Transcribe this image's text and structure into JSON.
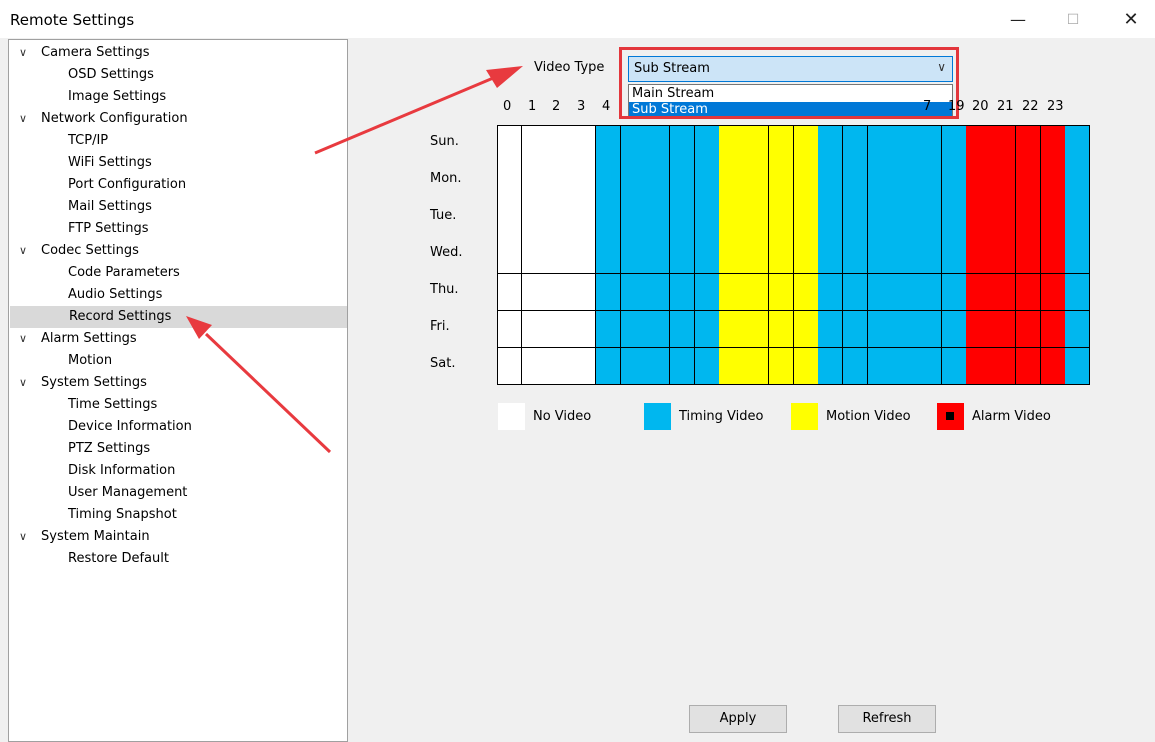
{
  "window": {
    "title": "Remote Settings",
    "controls": {
      "minimize": "—",
      "maximize": "☐",
      "close": "✕"
    }
  },
  "tree": {
    "selected": "Record Settings",
    "nodes": [
      {
        "label": "Camera Settings",
        "level": 0
      },
      {
        "label": "OSD Settings",
        "level": 1
      },
      {
        "label": "Image Settings",
        "level": 1
      },
      {
        "label": "Network Configuration",
        "level": 0
      },
      {
        "label": "TCP/IP",
        "level": 1
      },
      {
        "label": "WiFi Settings",
        "level": 1
      },
      {
        "label": "Port Configuration",
        "level": 1
      },
      {
        "label": "Mail Settings",
        "level": 1
      },
      {
        "label": "FTP Settings",
        "level": 1
      },
      {
        "label": "Codec Settings",
        "level": 0
      },
      {
        "label": "Code Parameters",
        "level": 1
      },
      {
        "label": "Audio Settings",
        "level": 1
      },
      {
        "label": "Record Settings",
        "level": 1
      },
      {
        "label": "Alarm Settings",
        "level": 0
      },
      {
        "label": "Motion",
        "level": 1
      },
      {
        "label": "System Settings",
        "level": 0
      },
      {
        "label": "Time Settings",
        "level": 1
      },
      {
        "label": "Device Information",
        "level": 1
      },
      {
        "label": "PTZ Settings",
        "level": 1
      },
      {
        "label": "Disk Information",
        "level": 1
      },
      {
        "label": "User Management",
        "level": 1
      },
      {
        "label": "Timing Snapshot",
        "level": 1
      },
      {
        "label": "System Maintain",
        "level": 0
      },
      {
        "label": "Restore Default",
        "level": 1
      }
    ]
  },
  "video_type": {
    "label": "Video Type",
    "selected": "Sub Stream",
    "options": [
      "Main Stream",
      "Sub Stream"
    ],
    "highlighted": "Sub Stream"
  },
  "schedule": {
    "hours": [
      "0",
      "1",
      "2",
      "3",
      "4",
      "",
      "",
      "",
      "",
      "",
      "",
      "",
      "",
      "",
      "",
      "",
      "",
      "7",
      "19",
      "20",
      "21",
      "22",
      "23"
    ],
    "days": [
      "Sun.",
      "Mon.",
      "Tue.",
      "Wed.",
      "Thu.",
      "Fri.",
      "Sat."
    ],
    "hour_types": [
      "none",
      "none",
      "none",
      "none",
      "timing",
      "timing",
      "timing",
      "timing",
      "timing",
      "motion",
      "motion",
      "motion",
      "motion",
      "timing",
      "timing",
      "timing",
      "timing",
      "timing",
      "timing",
      "alarm",
      "alarm",
      "alarm",
      "alarm",
      "timing"
    ],
    "colors": {
      "none": "#ffffff",
      "timing": "#00b7ef",
      "motion": "#ffff00",
      "alarm": "#ff0000"
    }
  },
  "legend": {
    "none": "No Video",
    "timing": "Timing Video",
    "motion": "Motion Video",
    "alarm": "Alarm Video"
  },
  "buttons": {
    "apply": "Apply",
    "refresh": "Refresh"
  }
}
